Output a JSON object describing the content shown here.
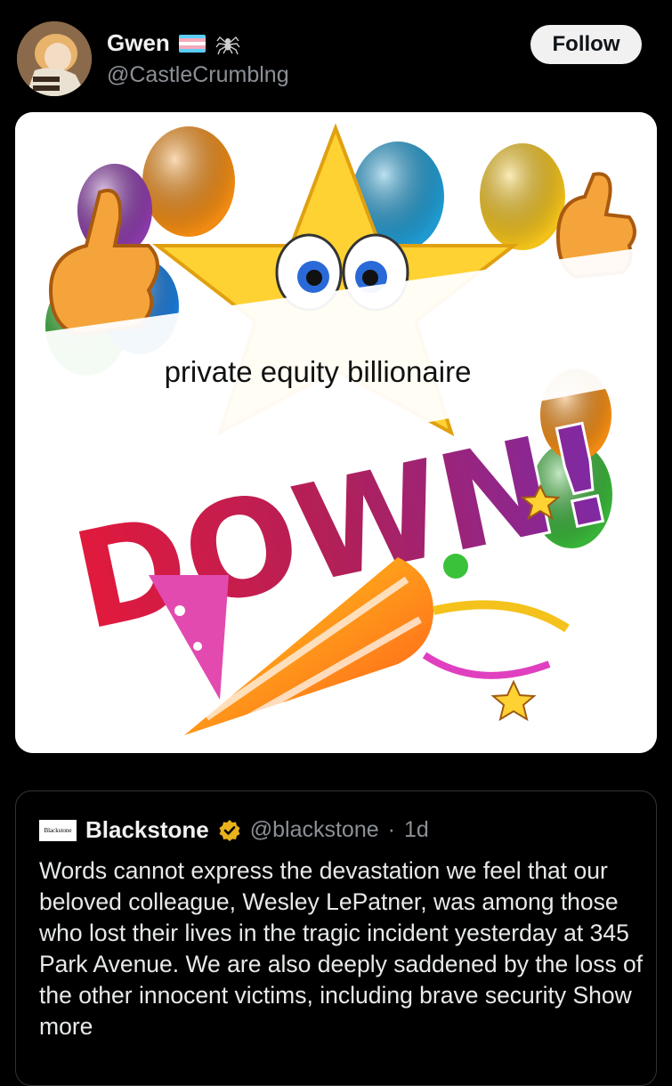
{
  "post": {
    "display_name": "Gwen",
    "name_icons": [
      "transgender-flag-icon",
      "spider-icon"
    ],
    "handle": "@CastleCrumblng",
    "follow_label": "Follow"
  },
  "media": {
    "overlay_text": "private equity billionaire",
    "banner_text": "DOWN!"
  },
  "quote": {
    "logo_text": "Blackstone",
    "name": "Blackstone",
    "verified_icon": "gold-verified-badge-icon",
    "handle": "@blackstone",
    "separator": "·",
    "time": "1d",
    "text": "Words cannot express the devastation we feel that our beloved colleague, Wesley LePatner, was among those who lost their lives in the tragic incident yesterday at 345 Park Avenue. We are also deeply saddened by the loss of the other innocent victims, including brave security",
    "show_more": "Show more"
  },
  "colors": {
    "background": "#000000",
    "follow_bg": "#f1f1f1",
    "secondary_text": "#8b9096",
    "verified_gold": "#e8b21c"
  }
}
